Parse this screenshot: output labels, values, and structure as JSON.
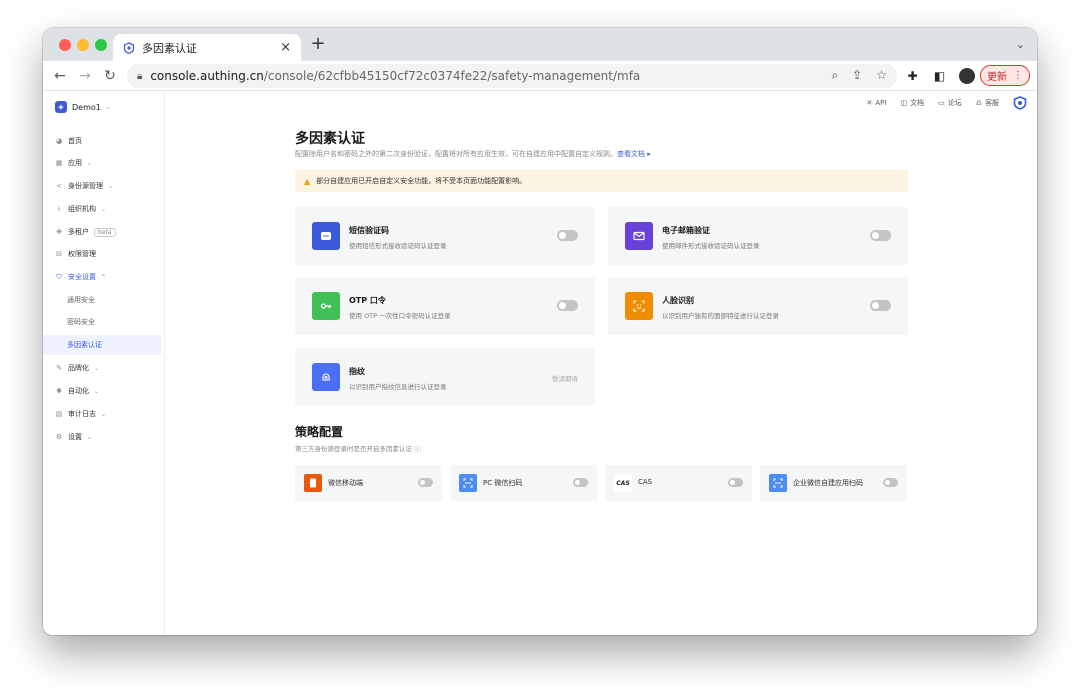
{
  "browser": {
    "tab_title": "多因素认证",
    "url_host": "console.authing.cn",
    "url_path": "/console/62cfbb45150cf72c0374fe22/safety-management/mfa",
    "update_label": "更新"
  },
  "sidebar": {
    "org_name": "Demo1",
    "items": [
      {
        "label": "首页"
      },
      {
        "label": "应用"
      },
      {
        "label": "身份源管理"
      },
      {
        "label": "组织机构"
      },
      {
        "label": "多租户",
        "badge": "beta"
      },
      {
        "label": "权限管理"
      },
      {
        "label": "安全设置"
      },
      {
        "label": "通用安全"
      },
      {
        "label": "密码安全"
      },
      {
        "label": "多因素认证"
      },
      {
        "label": "品牌化"
      },
      {
        "label": "自动化"
      },
      {
        "label": "审计日志"
      },
      {
        "label": "设置"
      }
    ]
  },
  "topbar": {
    "api": "API",
    "docs": "文档",
    "forum": "论坛",
    "support": "客服"
  },
  "page": {
    "title": "多因素认证",
    "description": "配置除用户名和密码之外的第二次身份验证，配置将对所有应用生效，可在自建应用中配置自定义规则。",
    "doc_link": "查看文档 ▸",
    "alert": "部分自建应用已开启自定义安全功能，将不受本页面功能配置影响。"
  },
  "mfa_cards": [
    {
      "title": "短信验证码",
      "desc": "使用短信形式接收验证码认证登录",
      "color": "#3b5bdb",
      "icon": "sms-icon",
      "enabled": false
    },
    {
      "title": "电子邮箱验证",
      "desc": "使用邮件形式接收验证码认证登录",
      "color": "#6741d9",
      "icon": "email-icon",
      "enabled": false
    },
    {
      "title": "OTP 口令",
      "desc": "使用 OTP 一次性口令密码认证登录",
      "color": "#40c057",
      "icon": "key-icon",
      "enabled": false
    },
    {
      "title": "人脸识别",
      "desc": "以识别用户独有的面部特征进行认证登录",
      "color": "#f08c00",
      "icon": "face-icon",
      "enabled": false
    },
    {
      "title": "指纹",
      "desc": "以识别用户指纹信息进行认证登录",
      "color": "#4c6ef5",
      "icon": "fingerprint-icon",
      "status": "敬请期待"
    }
  ],
  "policy": {
    "title": "策略配置",
    "desc": "第三方身份源登录时是否开启多因素认证",
    "items": [
      {
        "label": "微信移动端",
        "color": "#e8590c",
        "icon": "wechat-mobile-icon",
        "enabled": false
      },
      {
        "label": "PC 微信扫码",
        "color": "#4c8cf5",
        "icon": "scan-icon",
        "enabled": false
      },
      {
        "label": "CAS",
        "color": "#ffffff",
        "icon": "cas-logo",
        "logo_text": "CAS",
        "enabled": false
      },
      {
        "label": "企业微信自建应用扫码",
        "color": "#4c8cf5",
        "icon": "scan-icon",
        "enabled": false
      }
    ]
  }
}
